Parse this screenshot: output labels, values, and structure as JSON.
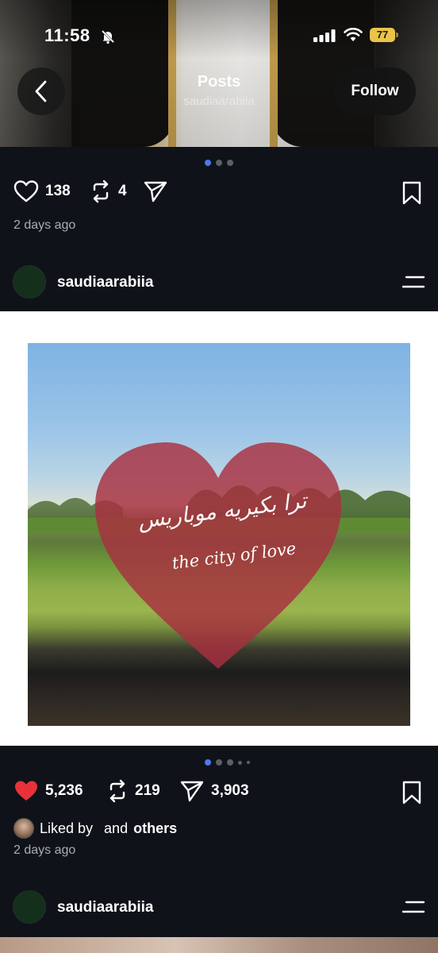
{
  "status_bar": {
    "time": "11:58",
    "battery": "77",
    "icons": [
      "bell-slash-icon",
      "signal-icon",
      "wifi-icon",
      "battery-icon"
    ]
  },
  "header": {
    "title": "Posts",
    "subtitle": "saudiaarabiia",
    "follow_label": "Follow",
    "back_icon": "chevron-left-icon"
  },
  "previous_post": {
    "likes": "138",
    "reposts": "4",
    "time_ago": "2 days ago",
    "carousel": {
      "count": 3,
      "active": 0
    }
  },
  "main_post": {
    "username": "saudiaarabiia",
    "image_caption_arabic": "ترا بكيريه موباريس",
    "image_caption_english": "the city of love",
    "carousel": {
      "count": 5,
      "active": 0
    },
    "likes": "5,236",
    "reposts": "219",
    "shares": "3,903",
    "liked_prefix": "Liked by",
    "liked_by": "",
    "liked_suffix": "and",
    "liked_others": "others",
    "time_ago": "2 days ago",
    "colors": {
      "like_active": "#e8323a",
      "heart_overlay": "#a8303f"
    }
  },
  "next_post": {
    "username": "saudiaarabiia"
  },
  "colors": {
    "background": "#0f1319",
    "accent_dot": "#4b78f0",
    "muted_text": "#a9adb4"
  }
}
